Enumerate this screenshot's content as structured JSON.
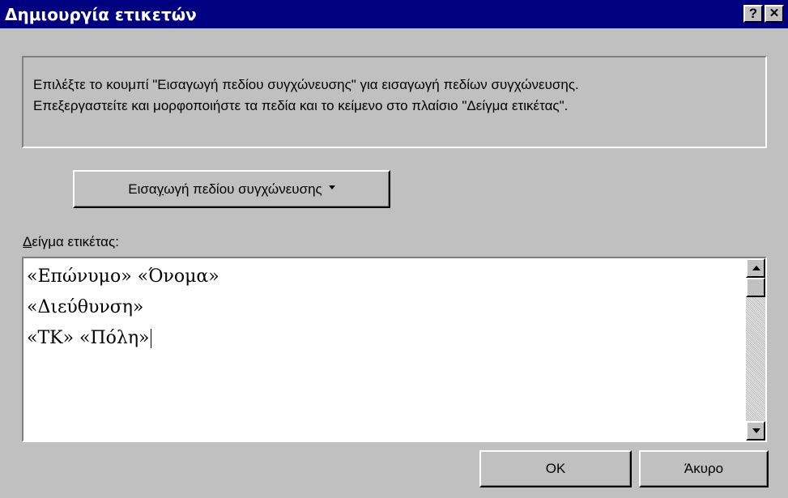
{
  "window": {
    "title": "Δημιουργία ετικετών",
    "help_label": "?",
    "close_label": "✕"
  },
  "instructions": {
    "line1": "Επιλέξτε το κουμπί \"Εισαγωγή πεδίου συγχώνευσης\" για εισαγωγή πεδίων συγχώνευσης.",
    "line2": "Επεξεργαστείτε και μορφοποιήστε τα πεδία και το κείμενο στο πλαίσιο \"Δείγμα ετικέτας\"."
  },
  "insert_field_button": {
    "label_pre": "Εισα",
    "label_accel": "γ",
    "label_post": "ωγή πεδίου συγχώνευσης",
    "icon": "chevron-down-icon"
  },
  "sample": {
    "label_accel": "Δ",
    "label_rest": "είγμα ετικέτας:",
    "lines": [
      "«Επώνυμο» «Όνομα»",
      "«Διεύθυνση»",
      "«ΤΚ» «Πόλη»"
    ]
  },
  "buttons": {
    "ok": "OK",
    "cancel": "Άκυρο"
  },
  "colors": {
    "title_bar": "#000080",
    "face": "#c0c0c0"
  }
}
